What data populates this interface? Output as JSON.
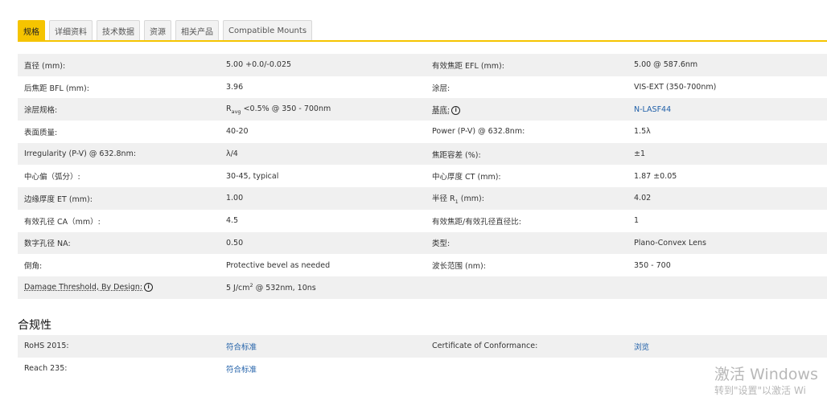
{
  "tabs": [
    "规格",
    "详细资料",
    "技术数据",
    "资源",
    "相关产品",
    "Compatible Mounts"
  ],
  "spec_rows": [
    {
      "l1": "直径 (mm):",
      "v1": "5.00 +0.0/-0.025",
      "l2": "有效焦距 EFL (mm):",
      "v2": "5.00 @ 587.6nm"
    },
    {
      "l1": "后焦距 BFL (mm):",
      "v1": "3.96",
      "l2": "涂层:",
      "v2": "VIS-EXT (350-700nm)"
    },
    {
      "l1": "涂层规格:",
      "v1_prefix": "R",
      "v1_sub": "avg",
      "v1_rest": " <0.5% @ 350 - 700nm",
      "l2": "基底:",
      "v2": "N-LASF44"
    },
    {
      "l1": "表面质量:",
      "v1": "40-20",
      "l2": "Power (P-V) @ 632.8nm:",
      "v2": "1.5λ"
    },
    {
      "l1": "Irregularity (P-V) @ 632.8nm:",
      "v1": "λ/4",
      "l2": "焦距容差 (%):",
      "v2": "±1"
    },
    {
      "l1": "中心偏（弧分）:",
      "v1": "30-45, typical",
      "l2": "中心厚度 CT (mm):",
      "v2": "1.87 ±0.05"
    },
    {
      "l1": "边缘厚度 ET (mm):",
      "v1": "1.00",
      "l2_prefix": "半径 R",
      "l2_sub": "1",
      "l2_rest": " (mm):",
      "v2": "4.02"
    },
    {
      "l1": "有效孔径 CA（mm）:",
      "v1": "4.5",
      "l2": "有效焦距/有效孔径直径比:",
      "v2": "1"
    },
    {
      "l1": "数字孔径 NA:",
      "v1": "0.50",
      "l2": "类型:",
      "v2": "Plano-Convex Lens"
    },
    {
      "l1": "倒角:",
      "v1": "Protective bevel as needed",
      "l2": "波长范围 (nm):",
      "v2": "350 - 700"
    },
    {
      "l1": "Damage Threshold, By Design:",
      "v1_prefix": "5 J/cm",
      "v1_sup": "2",
      "v1_rest": " @ 532nm, 10ns",
      "l2": "",
      "v2": ""
    }
  ],
  "compliance": {
    "title": "合规性",
    "rows": [
      {
        "l1": "RoHS 2015:",
        "v1": "符合标准",
        "l2": "Certificate of Conformance:",
        "v2": "浏览"
      },
      {
        "l1": "Reach 235:",
        "v1": "符合标准",
        "l2": "",
        "v2": ""
      }
    ]
  },
  "info_glyph": "i",
  "watermark": {
    "line1": "激活 Windows",
    "line2": "转到\"设置\"以激活 Wi"
  },
  "colors": {
    "accent": "#f5c400",
    "link": "#1f5fa8",
    "row_alt": "#f0f0f0"
  }
}
